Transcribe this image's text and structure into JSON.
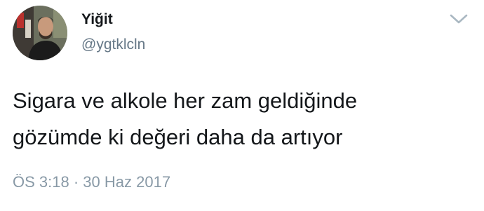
{
  "user": {
    "display_name": "Yiğit",
    "handle": "@ygtklcln",
    "avatar_icon": "profile-photo"
  },
  "menu": {
    "icon": "chevron-down-icon"
  },
  "tweet": {
    "lines": [
      "Sigara ve alkole her zam geldiğinde",
      "gözümde ki değeri daha da artıyor"
    ]
  },
  "meta": {
    "time": "ÖS 3:18",
    "separator": "·",
    "date": "30 Haz 2017"
  },
  "colors": {
    "text": "#14171a",
    "handle": "#657786",
    "timestamp": "#8899a6",
    "chevron": "#aab8c2"
  }
}
